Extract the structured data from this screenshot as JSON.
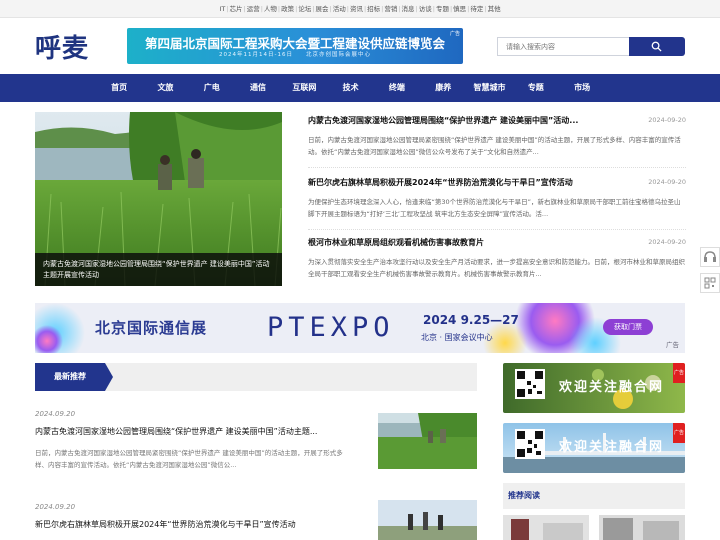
{
  "top_links": [
    "IT",
    "芯片",
    "运营",
    "人物",
    "政策",
    "论坛",
    "展会",
    "活动",
    "资讯",
    "招标",
    "营销",
    "消息",
    "访谈",
    "专题",
    "慎思",
    "待定",
    "其他"
  ],
  "logo": "呼麦",
  "header_banner": {
    "title": "第四届北京国际工程采购大会暨工程建设供应链博览会",
    "subtitle": "2024年11月14日-16日　　北京亦创国际会展中心",
    "ad_tag": "广告"
  },
  "search": {
    "placeholder": "请输入搜索内容"
  },
  "main_nav": [
    "首页",
    "文旅",
    "广电",
    "通信",
    "互联网",
    "技术",
    "终端",
    "康养",
    "智慧城市",
    "专题",
    "市场"
  ],
  "feature": {
    "caption": "内蒙古免渡河国家湿地公园管理局围绕“保护世界遗产 建设美丽中国”活动主题开展宣传活动"
  },
  "news": [
    {
      "title": "内蒙古免渡河国家湿地公园管理局围绕“保护世界遗产 建设美丽中国”活动...",
      "date": "2024-09-20",
      "summary": "日前，内蒙古免渡河国家湿地公园管理局紧密围绕“保护世界遗产 建设美丽中国”的活动主题，开展了形式多样、内容丰富的宣传活动。依托“内蒙古免渡河国家湿地公园”微信公众号发布了关于“文化和自然遗产..."
    },
    {
      "title": "新巴尔虎右旗林草局积极开展2024年“世界防治荒漠化与干旱日”宣传活动",
      "date": "2024-09-20",
      "summary": "为便保护生态环境理念深入人心，恰逢来临“第30个世界防治荒漠化与干旱日”，新右旗林业和草原局干部职工前往宝格德乌拉圣山脚下开展主题标语为“打好‘三北’工程攻坚战 筑牢北方生态安全屏障”宣传活动。活..."
    },
    {
      "title": "根河市林业和草原局组织观看机械伤害事故教育片",
      "date": "2024-09-20",
      "summary": "为深入贯彻落实安全生产治本攻坚行动以及安全生产月活动要求，进一步提高安全意识和防范能力。日前，根河市林业和草原局组织全局干部职工观看安全生产机械伤害事故警示教育片。机械伤害事故警示教育片..."
    }
  ],
  "wide_banner": {
    "zh_title": "北京国际通信展",
    "en_title": "PTEXPO",
    "date_text": "2024 9.25—27",
    "location": "北京 · 国家会议中心",
    "cta": "获取门票",
    "ad_tag": "广告"
  },
  "latest": {
    "section_label": "最新推荐",
    "items": [
      {
        "date": "2024.09.20",
        "title": "内蒙古免渡河国家湿地公园管理局围绕“保护世界遗产 建设美丽中国”活动主题...",
        "summary": "日前，内蒙古免渡河国家湿地公园管理局紧密围绕“保护世界遗产 建设美丽中国”的活动主题，开展了形式多样、内容丰富的宣传活动。依托“内蒙古免渡河国家湿地公园”微信公..."
      },
      {
        "date": "2024.09.20",
        "title": "新巴尔虎右旗林草局积极开展2024年“世界防治荒漠化与干旱日”宣传活动",
        "summary": ""
      }
    ]
  },
  "side_ads": [
    {
      "text": "欢迎关注融合网",
      "tag": "广告"
    },
    {
      "text": "欢迎关注融合网",
      "tag": "广告"
    }
  ],
  "recommend_label": "推荐阅读",
  "colors": {
    "brand_navy": "#22358d",
    "accent_purple": "#8d3fd4"
  }
}
